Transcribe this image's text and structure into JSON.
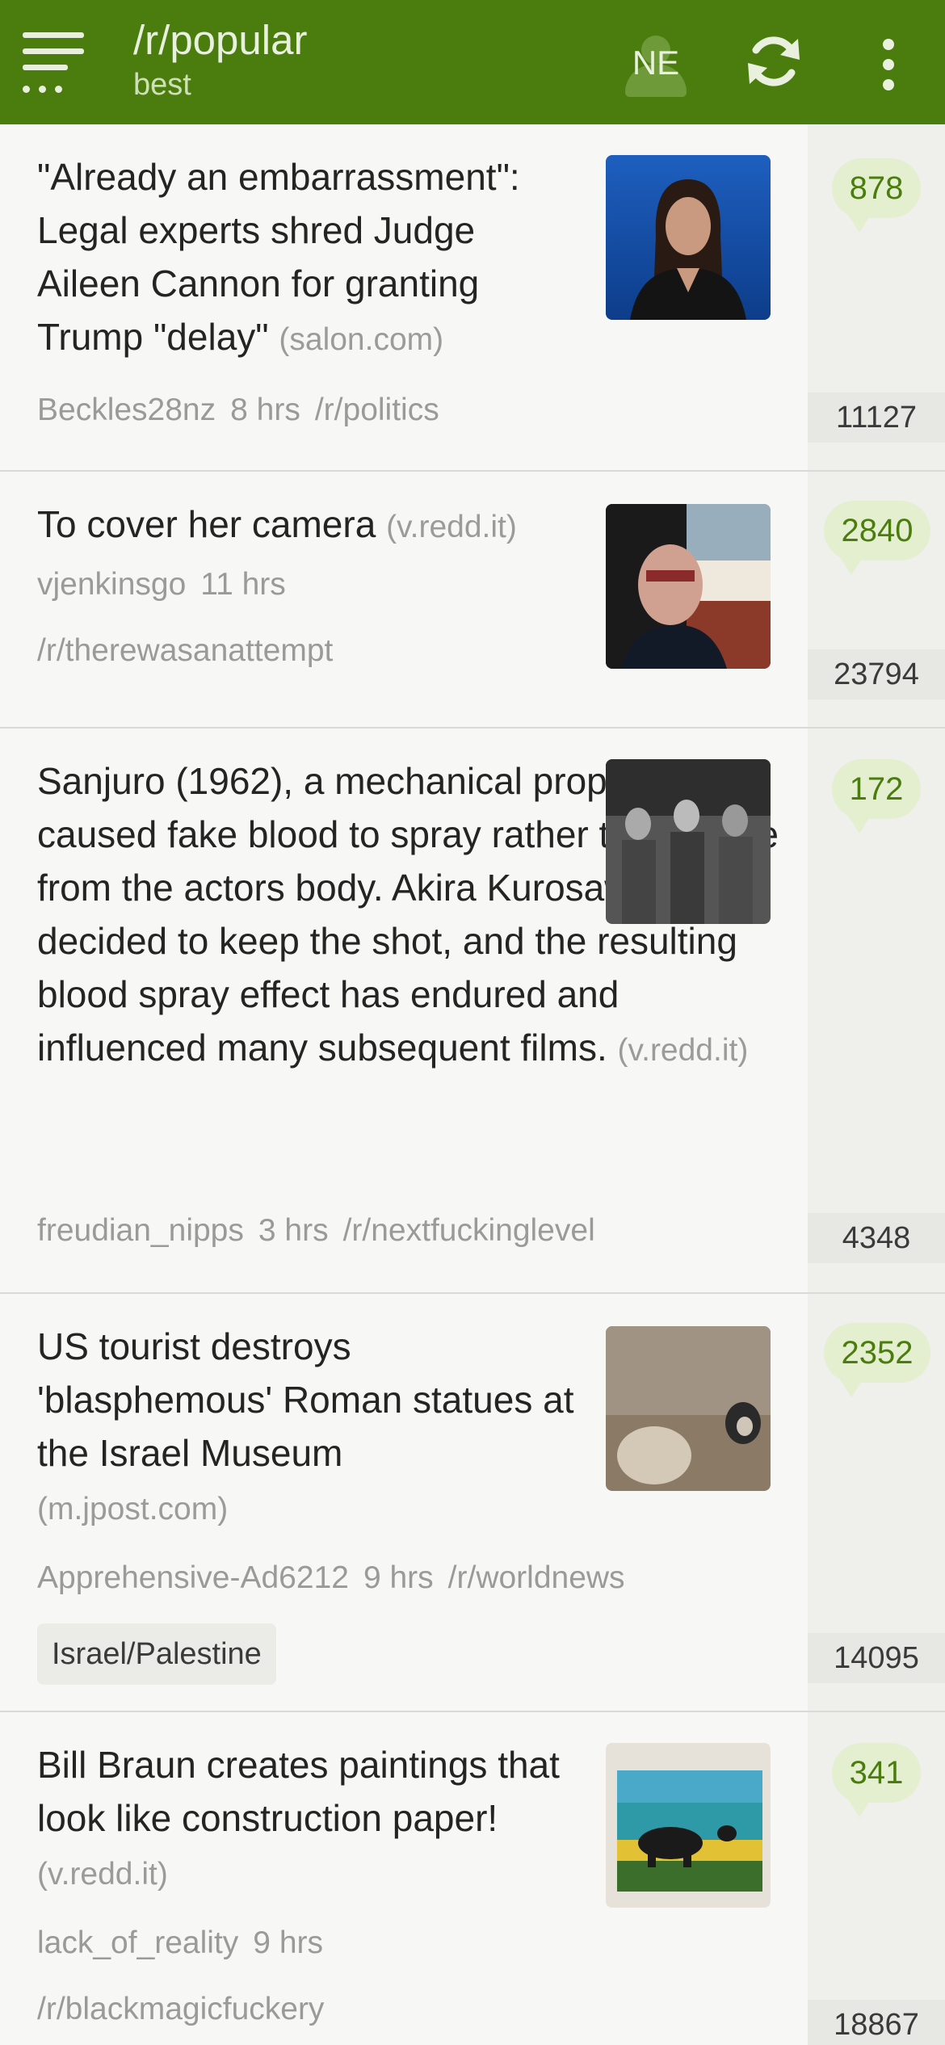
{
  "appbar": {
    "title": "/r/popular",
    "subtitle": "best",
    "account_label": "NE",
    "icons": {
      "menu": "menu-icon",
      "account": "account-icon",
      "refresh": "refresh-icon",
      "overflow": "more-vert-icon"
    }
  },
  "colors": {
    "appbar": "#4a7d0e",
    "accent": "#4a7d0e",
    "bubble": "#e4efcf"
  },
  "posts": [
    {
      "title": "\"Already an embarrassment\": Legal experts shred Judge Aileen Cannon for granting Trump \"delay\"",
      "domain": "(salon.com)",
      "author": "Beckles28nz",
      "age": "8 hrs",
      "subreddit": "/r/politics",
      "comments": "878",
      "score": "11127"
    },
    {
      "title": "To cover her camera",
      "domain": "(v.redd.it)",
      "author": "vjenkinsgo",
      "age": "11 hrs",
      "subreddit": "/r/therewasanattempt",
      "comments": "2840",
      "score": "23794"
    },
    {
      "title": "Sanjuro (1962), a mechanical prop failure caused fake blood to spray rather than trickle from the actors body. Akira Kurosawa decided to keep the shot, and the resulting blood spray effect has endured and influenced many subsequent films.",
      "domain": "(v.redd.it)",
      "author": "freudian_nipps",
      "age": "3 hrs",
      "subreddit": "/r/nextfuckinglevel",
      "comments": "172",
      "score": "4348"
    },
    {
      "title": "US tourist destroys 'blasphemous' Roman statues at the Israel Museum",
      "domain": "(m.jpost.com)",
      "author": "Apprehensive-Ad6212",
      "age": "9 hrs",
      "subreddit": "/r/worldnews",
      "flair": "Israel/Palestine",
      "comments": "2352",
      "score": "14095"
    },
    {
      "title": "Bill Braun creates paintings that look like construction paper!",
      "domain": "(v.redd.it)",
      "author": "lack_of_reality",
      "age": "9 hrs",
      "subreddit": "/r/blackmagicfuckery",
      "comments": "341",
      "score": "18867"
    }
  ]
}
